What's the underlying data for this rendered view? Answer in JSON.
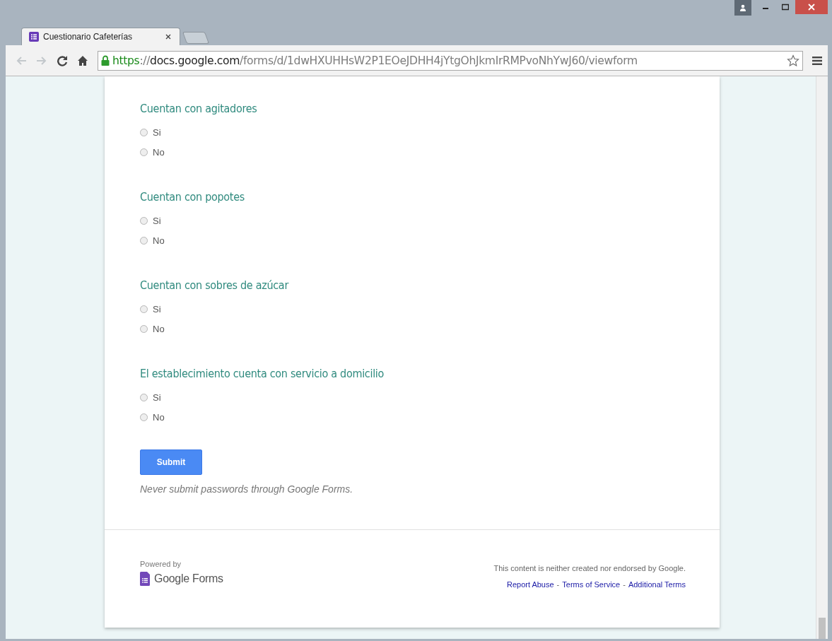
{
  "browser": {
    "tab": {
      "title": "Cuestionario Cafeterías",
      "selected": true
    },
    "address": [
      {
        "kind": "scheme",
        "text": "https"
      },
      {
        "kind": "sep",
        "text": "://"
      },
      {
        "kind": "host",
        "text": "docs.google.com"
      },
      {
        "kind": "path",
        "text": "/forms/d/1dwHXUHHsW2P1EOeJDHH4jYtgOhJkmIrRMPvoNhYwJ60/viewform"
      }
    ]
  },
  "questions": [
    {
      "title": "Cuentan con agitadores",
      "options": [
        {
          "label": "Si",
          "selected": false
        },
        {
          "label": "No",
          "selected": false
        }
      ]
    },
    {
      "title": "Cuentan con popotes",
      "options": [
        {
          "label": "Si",
          "selected": false
        },
        {
          "label": "No",
          "selected": false
        }
      ]
    },
    {
      "title": "Cuentan con sobres de azúcar",
      "options": [
        {
          "label": "Si",
          "selected": false
        },
        {
          "label": "No",
          "selected": false
        }
      ]
    },
    {
      "title": "El establecimiento cuenta con servicio a domicilio",
      "options": [
        {
          "label": "Si",
          "selected": false
        },
        {
          "label": "No",
          "selected": false
        }
      ]
    }
  ],
  "submit": {
    "label": "Submit",
    "note": "Never submit passwords through Google Forms."
  },
  "footer": {
    "powered_by": "Powered by",
    "brand": "Google Forms",
    "disclaimer": "This content is neither created nor endorsed by Google.",
    "links": [
      {
        "kind": "link",
        "text": "Report Abuse"
      },
      {
        "kind": "sep",
        "text": "-"
      },
      {
        "kind": "link",
        "text": "Terms of Service"
      },
      {
        "kind": "sep",
        "text": "-"
      },
      {
        "kind": "link",
        "text": "Additional Terms"
      }
    ]
  }
}
